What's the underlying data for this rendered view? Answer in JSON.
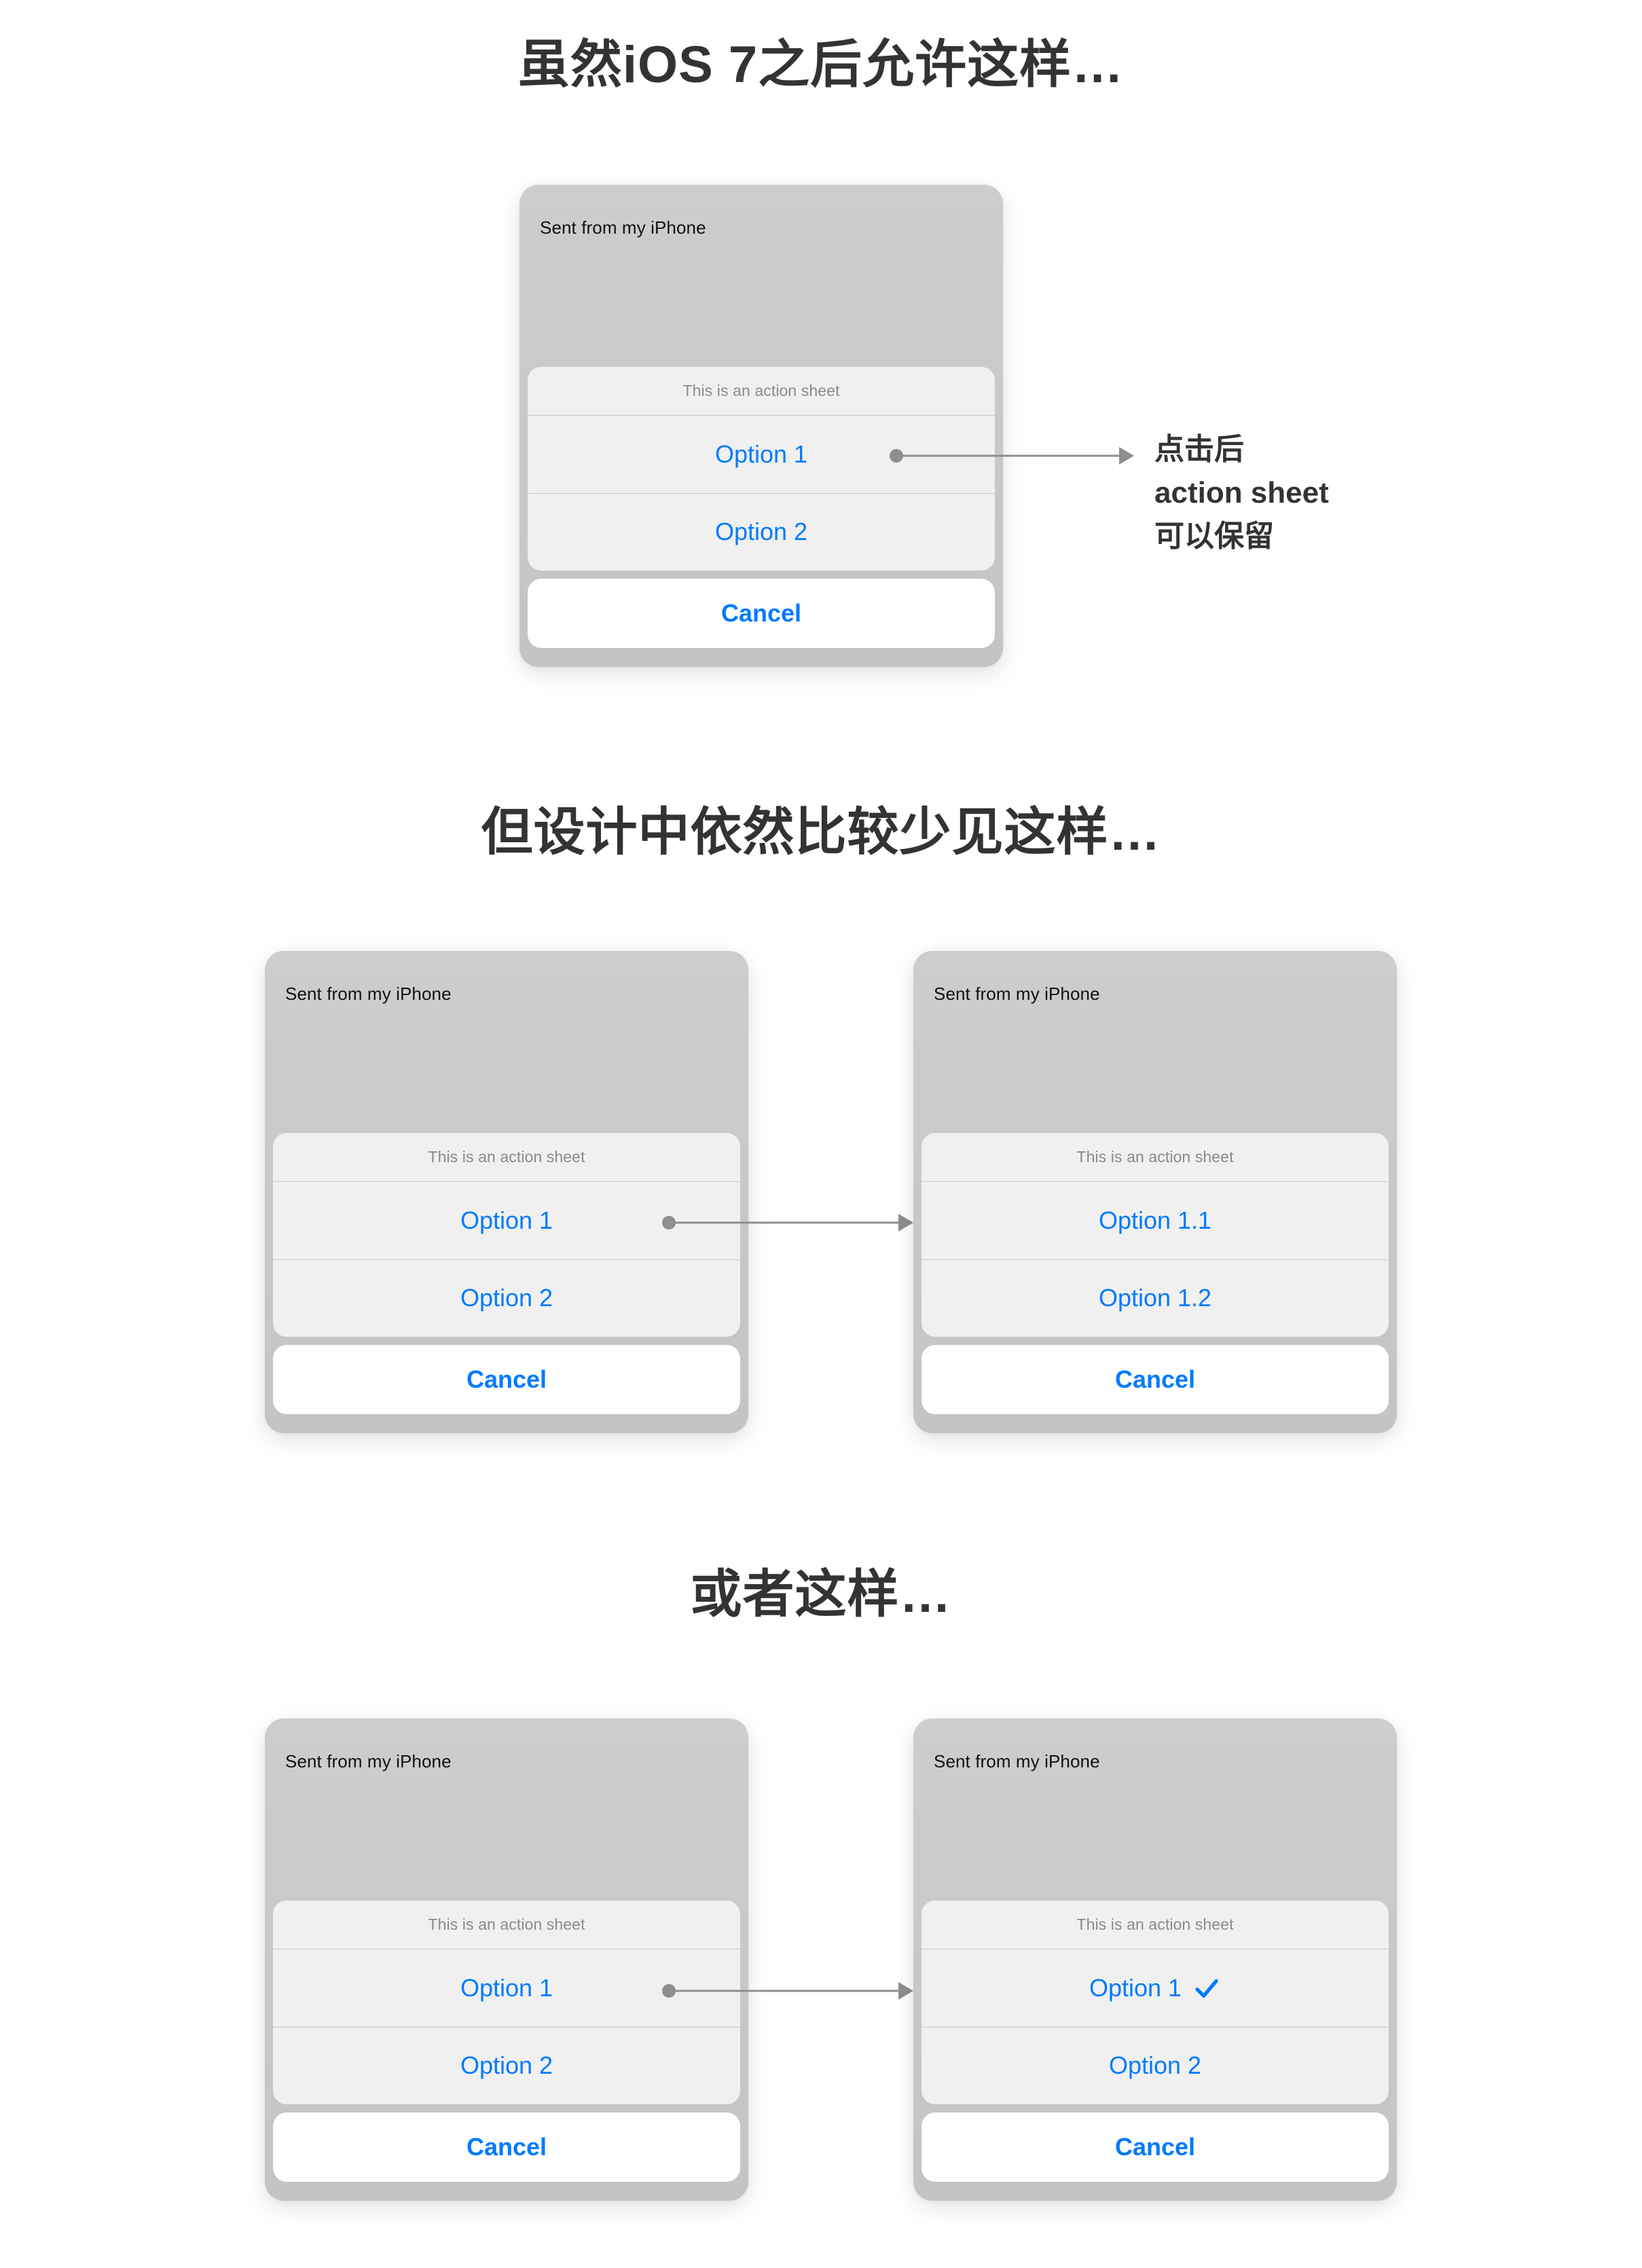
{
  "page": {
    "background": "#ffffff",
    "accent_blue": "#007aff",
    "card_gray": "#c8c8c8",
    "sheet_gray": "#f0f0f0",
    "heading_color": "#333333",
    "connector_gray": "#8e8e8e"
  },
  "sections": [
    {
      "heading": "虽然iOS 7之后允许这样…",
      "cards": [
        {
          "body_text": "Sent from my iPhone",
          "sheet_title": "This is an action sheet",
          "options": [
            "Option 1",
            "Option 2"
          ],
          "cancel": "Cancel",
          "checked_index": -1
        }
      ],
      "annotation_lines": [
        "点击后",
        "action sheet",
        "可以保留"
      ]
    },
    {
      "heading": "但设计中依然比较少见这样…",
      "cards": [
        {
          "body_text": "Sent from my iPhone",
          "sheet_title": "This is an action sheet",
          "options": [
            "Option 1",
            "Option 2"
          ],
          "cancel": "Cancel",
          "checked_index": -1
        },
        {
          "body_text": "Sent from my iPhone",
          "sheet_title": "This is an action sheet",
          "options": [
            "Option 1.1",
            "Option 1.2"
          ],
          "cancel": "Cancel",
          "checked_index": -1
        }
      ],
      "annotation_lines": []
    },
    {
      "heading": "或者这样…",
      "cards": [
        {
          "body_text": "Sent from my iPhone",
          "sheet_title": "This is an action sheet",
          "options": [
            "Option 1",
            "Option 2"
          ],
          "cancel": "Cancel",
          "checked_index": -1
        },
        {
          "body_text": "Sent from my iPhone",
          "sheet_title": "This is an action sheet",
          "options": [
            "Option 1",
            "Option 2"
          ],
          "cancel": "Cancel",
          "checked_index": 0
        }
      ],
      "annotation_lines": []
    }
  ],
  "icons": {
    "checkmark": "check-icon",
    "arrow": "arrow-right-icon",
    "dot": "anchor-dot-icon"
  }
}
